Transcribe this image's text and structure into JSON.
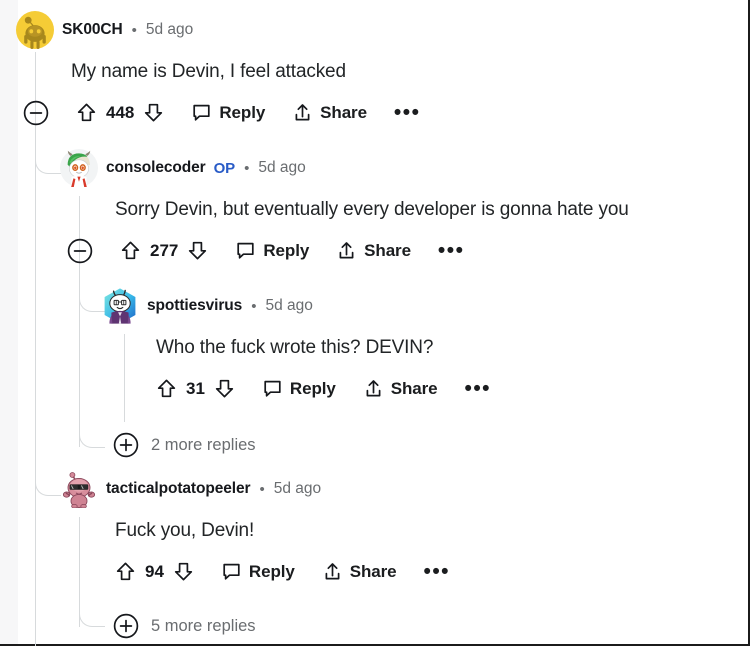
{
  "thread": {
    "comments": [
      {
        "id": "c1",
        "username": "SK00CH",
        "op": false,
        "op_label": "",
        "separator": "•",
        "timestamp": "5d ago",
        "body": "My name is Devin, I feel attacked",
        "votes": "448",
        "reply_label": "Reply",
        "share_label": "Share",
        "overflow_label": "•••",
        "collapsible": true,
        "avatar": "snoo-yellow-avatar"
      },
      {
        "id": "c2",
        "username": "consolecoder",
        "op": true,
        "op_label": "OP",
        "separator": "•",
        "timestamp": "5d ago",
        "body": "Sorry Devin, but eventually every developer is gonna hate you",
        "votes": "277",
        "reply_label": "Reply",
        "share_label": "Share",
        "overflow_label": "•••",
        "collapsible": true,
        "avatar": "snoo-green-hat-avatar"
      },
      {
        "id": "c3",
        "username": "spottiesvirus",
        "op": false,
        "op_label": "",
        "separator": "•",
        "timestamp": "5d ago",
        "body": "Who the fuck wrote this? DEVIN?",
        "votes": "31",
        "reply_label": "Reply",
        "share_label": "Share",
        "overflow_label": "•••",
        "collapsible": false,
        "avatar": "snoo-purple-shirt-avatar"
      },
      {
        "id": "c4",
        "username": "tacticalpotatopeeler",
        "op": false,
        "op_label": "",
        "separator": "•",
        "timestamp": "5d ago",
        "body": "Fuck you, Devin!",
        "votes": "94",
        "reply_label": "Reply",
        "share_label": "Share",
        "overflow_label": "•••",
        "collapsible": false,
        "avatar": "snoo-pink-sunglasses-avatar"
      }
    ],
    "more_replies": [
      {
        "id": "m1",
        "label": "2 more replies",
        "expand_icon": "plus-circle-icon"
      },
      {
        "id": "m2",
        "label": "5 more replies",
        "expand_icon": "plus-circle-icon"
      }
    ]
  },
  "icons": {
    "collapse": "minus-circle-icon",
    "upvote": "upvote-arrow-icon",
    "downvote": "downvote-arrow-icon",
    "reply": "comment-bubble-icon",
    "share": "share-arrow-icon",
    "overflow": "ellipsis-icon",
    "expand": "plus-circle-icon"
  },
  "colors": {
    "background": "#ffffff",
    "gutter": "#f7f7f8",
    "text": "#222527",
    "muted": "#6a6d70",
    "op_blue": "#2a5cc7",
    "thread_line": "#d7dadc",
    "border": "#1b1b1b"
  }
}
